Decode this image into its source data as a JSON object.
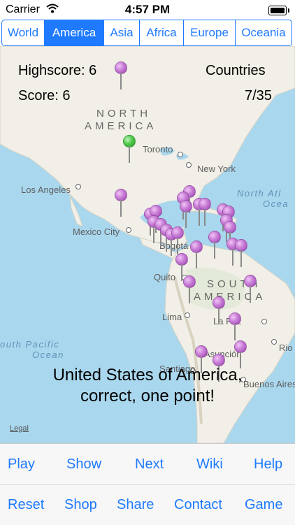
{
  "status_bar": {
    "carrier": "Carrier",
    "time": "4:57 PM"
  },
  "regions_tabs": [
    "World",
    "America",
    "Asia",
    "Africa",
    "Europe",
    "Oceania"
  ],
  "active_tab": "America",
  "hud": {
    "highscore": "Highscore: 6",
    "score": "Score: 6",
    "countries_label": "Countries",
    "progress": "7/35"
  },
  "map": {
    "region_north_1": "NORTH",
    "region_north_2": "AMERICA",
    "region_south_1": "SOUTH",
    "region_south_2": "AMERICA",
    "cities": {
      "toronto": "Toronto",
      "new_york": "New York",
      "los_angeles": "Los Angeles",
      "mexico_city": "Mexico City",
      "bogota": "Bogotá",
      "quito": "Quito",
      "lima": "Lima",
      "la_paz": "La Paz",
      "rio": "Rio",
      "asuncion": "Asunción",
      "santiago": "Santiago",
      "buenos_aires": "Buenos Aires"
    },
    "ocean_north_atlantic_1": "North Atl",
    "ocean_north_atlantic_2": "Ocea",
    "ocean_south_pacific_1": "outh Pacific",
    "ocean_south_pacific_2": "Ocean",
    "legal": "Legal"
  },
  "message_line1": "United States of America,",
  "message_line2": "correct, one point!",
  "toolbar_row1": [
    "Play",
    "Show",
    "Next",
    "Wiki",
    "Help"
  ],
  "toolbar_row2": [
    "Reset",
    "Shop",
    "Share",
    "Contact",
    "Game"
  ],
  "colors": {
    "accent": "#1f7aff",
    "pin": "#c77bd5",
    "pin_correct": "#4fca4a",
    "water": "#a9d7ee"
  }
}
